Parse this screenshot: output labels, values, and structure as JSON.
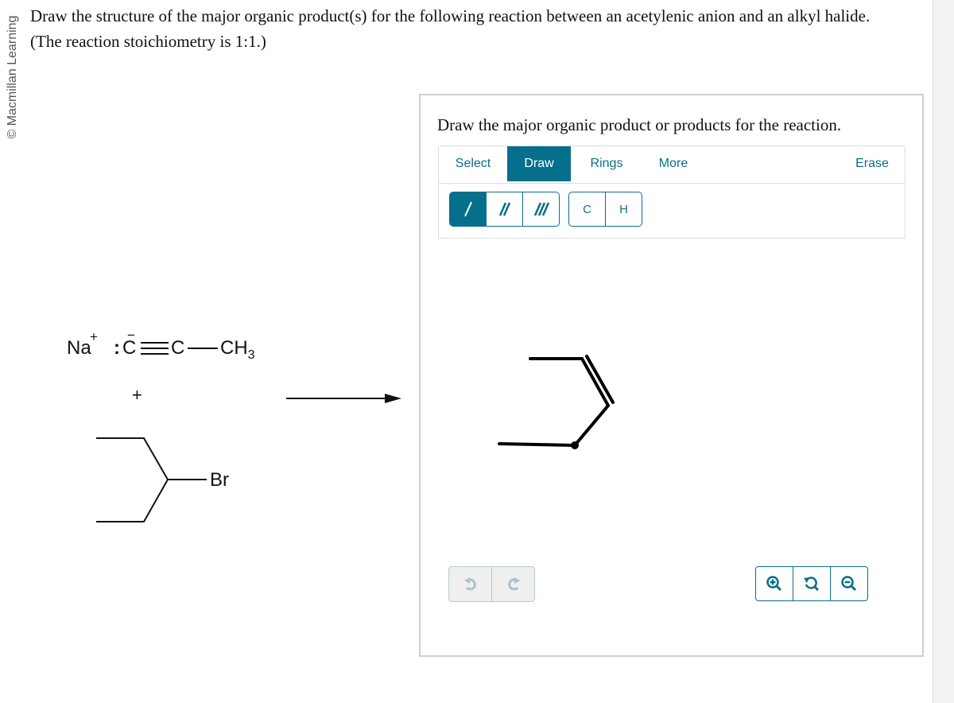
{
  "copyright": "© Macmillan Learning",
  "question": {
    "line1": "Draw the structure of the major organic product(s) for the following reaction between an acetylenic anion and an alkyl halide.",
    "line2": "(The reaction stoichiometry is 1:1.)"
  },
  "reactants": {
    "cation": "Na",
    "cation_charge": "+",
    "anion_charge": "−",
    "lone_pair": ":",
    "carbon1": "C",
    "carbon2": "C",
    "methyl": "CH",
    "methyl_sub": "3",
    "plus": "+",
    "halide_label": "Br"
  },
  "editor": {
    "prompt": "Draw the major organic product or products for the reaction.",
    "tabs": [
      {
        "label": "Select",
        "active": false
      },
      {
        "label": "Draw",
        "active": true
      },
      {
        "label": "Rings",
        "active": false
      },
      {
        "label": "More",
        "active": false
      },
      {
        "label": "Erase",
        "active": false
      }
    ],
    "bond_tools": [
      {
        "icon": "single-bond-icon",
        "active": true
      },
      {
        "icon": "double-bond-icon",
        "active": false
      },
      {
        "icon": "triple-bond-icon",
        "active": false
      }
    ],
    "atom_tools": [
      "C",
      "H"
    ],
    "history_tools": [
      {
        "icon": "undo-icon",
        "enabled": false
      },
      {
        "icon": "redo-icon",
        "enabled": false
      }
    ],
    "zoom_tools": [
      {
        "icon": "zoom-in-icon"
      },
      {
        "icon": "zoom-reset-icon"
      },
      {
        "icon": "zoom-out-icon"
      }
    ],
    "colors": {
      "accent": "#06708c",
      "disabled": "#a9c2cc"
    }
  }
}
